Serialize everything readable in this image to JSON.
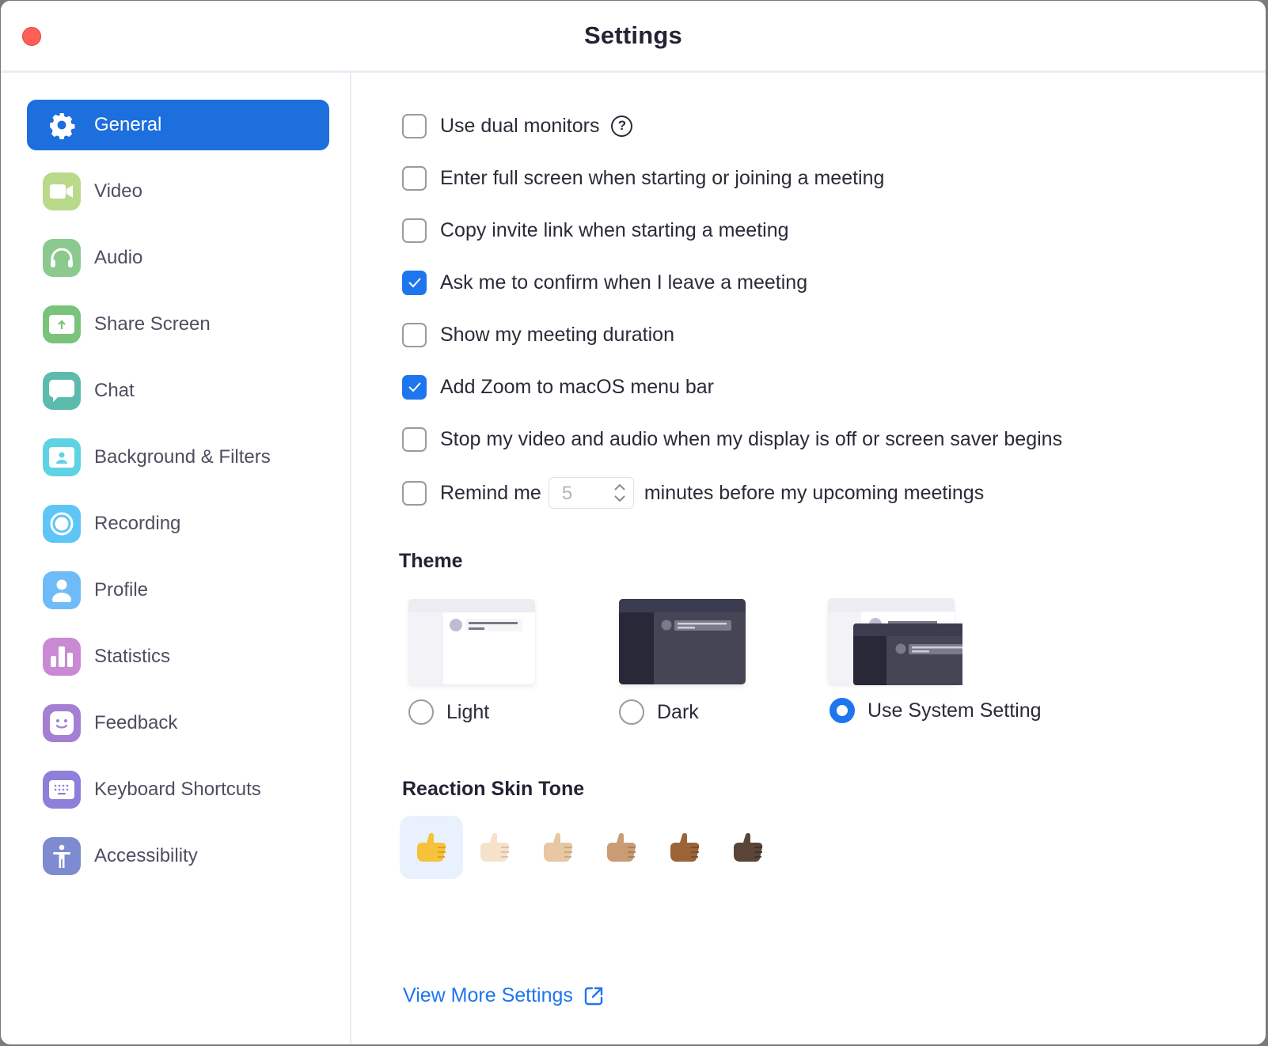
{
  "window": {
    "title": "Settings",
    "close_button": "close-window"
  },
  "sidebar": {
    "items": [
      {
        "label": "General",
        "icon": "gear-icon",
        "active": true,
        "color": "#1c6fdc"
      },
      {
        "label": "Video",
        "icon": "video-camera-icon",
        "color": "#b9d98b"
      },
      {
        "label": "Audio",
        "icon": "headphones-icon",
        "color": "#8bc98e"
      },
      {
        "label": "Share Screen",
        "icon": "share-screen-icon",
        "color": "#79c47a"
      },
      {
        "label": "Chat",
        "icon": "chat-bubble-icon",
        "color": "#5dbbad"
      },
      {
        "label": "Background & Filters",
        "icon": "background-portrait-icon",
        "color": "#5fd3e4"
      },
      {
        "label": "Recording",
        "icon": "record-icon",
        "color": "#5ec6f7"
      },
      {
        "label": "Profile",
        "icon": "person-icon",
        "color": "#6ebbf8"
      },
      {
        "label": "Statistics",
        "icon": "bar-chart-icon",
        "color": "#c98ad3"
      },
      {
        "label": "Feedback",
        "icon": "smiley-icon",
        "color": "#a47fd3"
      },
      {
        "label": "Keyboard Shortcuts",
        "icon": "keyboard-icon",
        "color": "#8c80da"
      },
      {
        "label": "Accessibility",
        "icon": "accessibility-icon",
        "color": "#7d8bd0"
      }
    ]
  },
  "general": {
    "options": [
      {
        "label": "Use dual monitors",
        "checked": false,
        "help": "?"
      },
      {
        "label": "Enter full screen when starting or joining a meeting",
        "checked": false
      },
      {
        "label": "Copy invite link when starting a meeting",
        "checked": false
      },
      {
        "label": "Ask me to confirm when I leave a meeting",
        "checked": true
      },
      {
        "label": "Show my meeting duration",
        "checked": false
      },
      {
        "label": "Add Zoom to macOS menu bar",
        "checked": true
      },
      {
        "label": "Stop my video and audio when my display is off or screen saver begins",
        "checked": false
      }
    ],
    "remind": {
      "checked": false,
      "label_before": "Remind me",
      "minutes_value": "5",
      "label_after": "minutes before my upcoming meetings"
    },
    "theme": {
      "heading": "Theme",
      "options": [
        {
          "label": "Light",
          "selected": false
        },
        {
          "label": "Dark",
          "selected": false
        },
        {
          "label": "Use System Setting",
          "selected": true
        }
      ]
    },
    "skin_tone": {
      "heading": "Reaction Skin Tone",
      "tones": [
        {
          "name": "default-yellow",
          "emoji": "👍",
          "selected": true
        },
        {
          "name": "light",
          "emoji": "👍🏻",
          "selected": false
        },
        {
          "name": "medium-light",
          "emoji": "👍🏼",
          "selected": false
        },
        {
          "name": "medium",
          "emoji": "👍🏽",
          "selected": false
        },
        {
          "name": "medium-dark",
          "emoji": "👍🏾",
          "selected": false
        },
        {
          "name": "dark",
          "emoji": "👍🏿",
          "selected": false
        }
      ]
    },
    "view_more": "View More Settings"
  },
  "colors": {
    "accent": "#1e76ee",
    "active_nav": "#1c6fdc",
    "text": "#2b2b38",
    "close": "#fe5f57"
  }
}
